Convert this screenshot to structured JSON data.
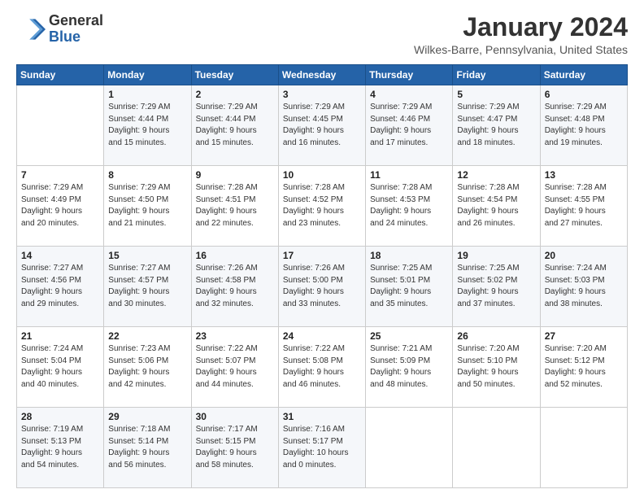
{
  "header": {
    "logo_general": "General",
    "logo_blue": "Blue",
    "title": "January 2024",
    "location": "Wilkes-Barre, Pennsylvania, United States"
  },
  "weekdays": [
    "Sunday",
    "Monday",
    "Tuesday",
    "Wednesday",
    "Thursday",
    "Friday",
    "Saturday"
  ],
  "weeks": [
    [
      {
        "day": "",
        "info": ""
      },
      {
        "day": "1",
        "info": "Sunrise: 7:29 AM\nSunset: 4:44 PM\nDaylight: 9 hours\nand 15 minutes."
      },
      {
        "day": "2",
        "info": "Sunrise: 7:29 AM\nSunset: 4:44 PM\nDaylight: 9 hours\nand 15 minutes."
      },
      {
        "day": "3",
        "info": "Sunrise: 7:29 AM\nSunset: 4:45 PM\nDaylight: 9 hours\nand 16 minutes."
      },
      {
        "day": "4",
        "info": "Sunrise: 7:29 AM\nSunset: 4:46 PM\nDaylight: 9 hours\nand 17 minutes."
      },
      {
        "day": "5",
        "info": "Sunrise: 7:29 AM\nSunset: 4:47 PM\nDaylight: 9 hours\nand 18 minutes."
      },
      {
        "day": "6",
        "info": "Sunrise: 7:29 AM\nSunset: 4:48 PM\nDaylight: 9 hours\nand 19 minutes."
      }
    ],
    [
      {
        "day": "7",
        "info": "Sunrise: 7:29 AM\nSunset: 4:49 PM\nDaylight: 9 hours\nand 20 minutes."
      },
      {
        "day": "8",
        "info": "Sunrise: 7:29 AM\nSunset: 4:50 PM\nDaylight: 9 hours\nand 21 minutes."
      },
      {
        "day": "9",
        "info": "Sunrise: 7:28 AM\nSunset: 4:51 PM\nDaylight: 9 hours\nand 22 minutes."
      },
      {
        "day": "10",
        "info": "Sunrise: 7:28 AM\nSunset: 4:52 PM\nDaylight: 9 hours\nand 23 minutes."
      },
      {
        "day": "11",
        "info": "Sunrise: 7:28 AM\nSunset: 4:53 PM\nDaylight: 9 hours\nand 24 minutes."
      },
      {
        "day": "12",
        "info": "Sunrise: 7:28 AM\nSunset: 4:54 PM\nDaylight: 9 hours\nand 26 minutes."
      },
      {
        "day": "13",
        "info": "Sunrise: 7:28 AM\nSunset: 4:55 PM\nDaylight: 9 hours\nand 27 minutes."
      }
    ],
    [
      {
        "day": "14",
        "info": "Sunrise: 7:27 AM\nSunset: 4:56 PM\nDaylight: 9 hours\nand 29 minutes."
      },
      {
        "day": "15",
        "info": "Sunrise: 7:27 AM\nSunset: 4:57 PM\nDaylight: 9 hours\nand 30 minutes."
      },
      {
        "day": "16",
        "info": "Sunrise: 7:26 AM\nSunset: 4:58 PM\nDaylight: 9 hours\nand 32 minutes."
      },
      {
        "day": "17",
        "info": "Sunrise: 7:26 AM\nSunset: 5:00 PM\nDaylight: 9 hours\nand 33 minutes."
      },
      {
        "day": "18",
        "info": "Sunrise: 7:25 AM\nSunset: 5:01 PM\nDaylight: 9 hours\nand 35 minutes."
      },
      {
        "day": "19",
        "info": "Sunrise: 7:25 AM\nSunset: 5:02 PM\nDaylight: 9 hours\nand 37 minutes."
      },
      {
        "day": "20",
        "info": "Sunrise: 7:24 AM\nSunset: 5:03 PM\nDaylight: 9 hours\nand 38 minutes."
      }
    ],
    [
      {
        "day": "21",
        "info": "Sunrise: 7:24 AM\nSunset: 5:04 PM\nDaylight: 9 hours\nand 40 minutes."
      },
      {
        "day": "22",
        "info": "Sunrise: 7:23 AM\nSunset: 5:06 PM\nDaylight: 9 hours\nand 42 minutes."
      },
      {
        "day": "23",
        "info": "Sunrise: 7:22 AM\nSunset: 5:07 PM\nDaylight: 9 hours\nand 44 minutes."
      },
      {
        "day": "24",
        "info": "Sunrise: 7:22 AM\nSunset: 5:08 PM\nDaylight: 9 hours\nand 46 minutes."
      },
      {
        "day": "25",
        "info": "Sunrise: 7:21 AM\nSunset: 5:09 PM\nDaylight: 9 hours\nand 48 minutes."
      },
      {
        "day": "26",
        "info": "Sunrise: 7:20 AM\nSunset: 5:10 PM\nDaylight: 9 hours\nand 50 minutes."
      },
      {
        "day": "27",
        "info": "Sunrise: 7:20 AM\nSunset: 5:12 PM\nDaylight: 9 hours\nand 52 minutes."
      }
    ],
    [
      {
        "day": "28",
        "info": "Sunrise: 7:19 AM\nSunset: 5:13 PM\nDaylight: 9 hours\nand 54 minutes."
      },
      {
        "day": "29",
        "info": "Sunrise: 7:18 AM\nSunset: 5:14 PM\nDaylight: 9 hours\nand 56 minutes."
      },
      {
        "day": "30",
        "info": "Sunrise: 7:17 AM\nSunset: 5:15 PM\nDaylight: 9 hours\nand 58 minutes."
      },
      {
        "day": "31",
        "info": "Sunrise: 7:16 AM\nSunset: 5:17 PM\nDaylight: 10 hours\nand 0 minutes."
      },
      {
        "day": "",
        "info": ""
      },
      {
        "day": "",
        "info": ""
      },
      {
        "day": "",
        "info": ""
      }
    ]
  ]
}
